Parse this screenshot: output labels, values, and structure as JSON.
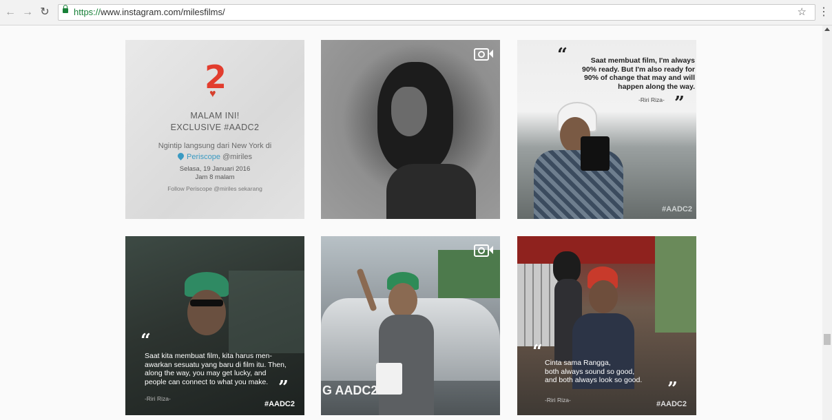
{
  "browser": {
    "url_scheme": "https://",
    "url_rest": "www.instagram.com/milesfilms/",
    "back_icon": "arrow-left-icon",
    "forward_icon": "arrow-right-icon",
    "reload_icon": "reload-icon",
    "star_icon": "star-icon",
    "menu_icon": "kebab-menu-icon"
  },
  "posts": [
    {
      "id": "post-1",
      "headline": "MALAM INI!",
      "headline2": "EXCLUSIVE #AADC2",
      "line1": "Ngintip langsung dari New York di",
      "periscope": "Periscope",
      "handle": "@miriles",
      "date": "Selasa, 19 Januari 2016",
      "time": "Jam 8 malam",
      "footer": "Follow Periscope @miriles sekarang"
    },
    {
      "id": "post-2",
      "is_video": true
    },
    {
      "id": "post-3",
      "quote": [
        "Saat membuat film, I'm always",
        "90% ready. But I'm also ready for",
        "90% of change that may and will",
        "happen along the way."
      ],
      "credit": "-Riri Riza-",
      "hashtag": "#AADC2"
    },
    {
      "id": "post-4",
      "quote": [
        "Saat kita membuat film, kita harus men-",
        "awarkan sesuatu yang baru di film itu. Then,",
        "along the way, you may get lucky, and",
        "people can connect to what you make."
      ],
      "credit": "-Riri Riza-",
      "hashtag": "#AADC2"
    },
    {
      "id": "post-5",
      "is_video": true,
      "slate_text": "G AADC2"
    },
    {
      "id": "post-6",
      "quote": [
        "Cinta sama Rangga,",
        "both always sound so good,",
        "and both always look so good."
      ],
      "credit": "-Riri Riza-",
      "hashtag": "#AADC2"
    }
  ],
  "colors": {
    "accent_link": "#3a9ac2",
    "secure_green": "#188038"
  }
}
